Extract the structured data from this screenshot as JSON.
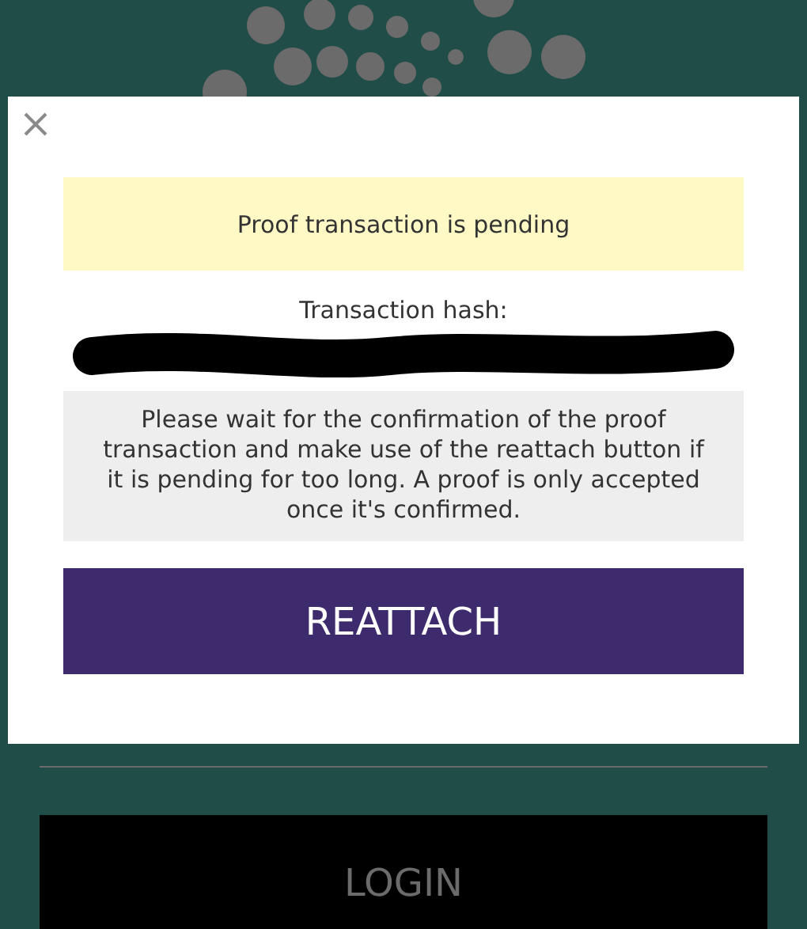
{
  "page": {
    "login_button": "LOGIN"
  },
  "modal": {
    "status": "Proof transaction is pending",
    "hash_label": "Transaction hash:",
    "info": "Please wait for the confirmation of the proof transaction and make use of the reattach button if it is pending for too long. A proof is only accepted once it's confirmed.",
    "action_button": "REATTACH"
  }
}
